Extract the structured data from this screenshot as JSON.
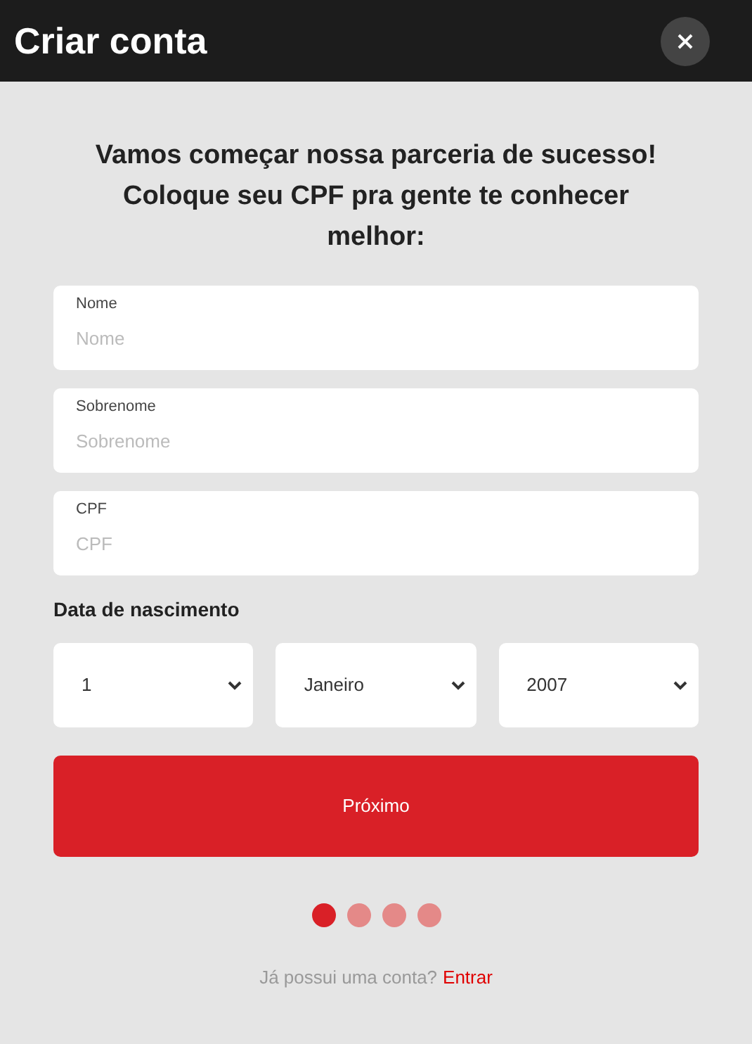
{
  "header": {
    "title": "Criar conta"
  },
  "intro": "Vamos começar nossa parceria de sucesso! Coloque seu CPF pra gente te conhecer melhor:",
  "fields": [
    {
      "label": "Nome",
      "placeholder": "Nome"
    },
    {
      "label": "Sobrenome",
      "placeholder": "Sobrenome"
    },
    {
      "label": "CPF",
      "placeholder": "CPF"
    }
  ],
  "birth_date": {
    "label": "Data de nascimento",
    "selects": [
      {
        "value": "1"
      },
      {
        "value": "Janeiro"
      },
      {
        "value": "2007"
      }
    ]
  },
  "next_button": "Próximo",
  "steps": [
    {
      "selected": true
    },
    {
      "selected": false
    },
    {
      "selected": false
    },
    {
      "selected": false
    }
  ],
  "login_prompt": {
    "text": "Já possui uma conta?",
    "link": "Entrar"
  }
}
